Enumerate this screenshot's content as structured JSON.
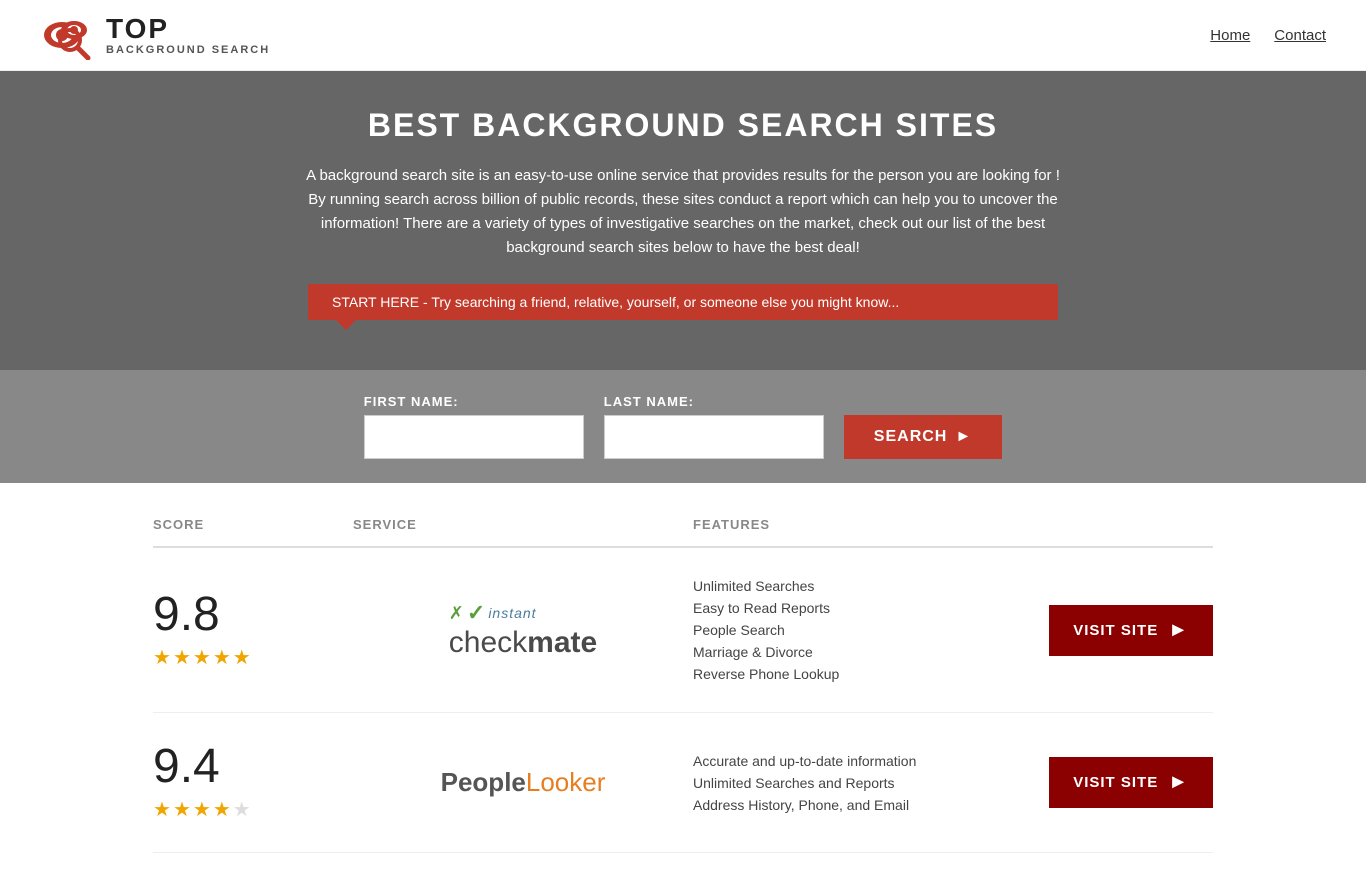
{
  "header": {
    "logo_top": "TOP",
    "logo_bottom": "BACKGROUND SEARCH",
    "nav_home": "Home",
    "nav_contact": "Contact"
  },
  "hero": {
    "title": "BEST BACKGROUND SEARCH SITES",
    "description": "A background search site is an easy-to-use online service that provides results  for the person you are looking for ! By  running  search across billion of public records, these sites conduct  a report which can help you to uncover the information! There are a variety of types of investigative searches on the market, check out our  list of the best background search sites below to have the best deal!",
    "callout": "START HERE - Try searching a friend, relative, yourself, or someone else you might know..."
  },
  "search_form": {
    "first_name_label": "FIRST NAME:",
    "last_name_label": "LAST NAME:",
    "button_label": "SEARCH"
  },
  "table": {
    "headers": {
      "score": "SCORE",
      "service": "SERVICE",
      "features": "FEATURES",
      "action": ""
    },
    "rows": [
      {
        "score": "9.8",
        "stars": 4.5,
        "service_name": "Instant Checkmate",
        "features": [
          "Unlimited Searches",
          "Easy to Read Reports",
          "People Search",
          "Marriage & Divorce",
          "Reverse Phone Lookup"
        ],
        "visit_label": "VISIT SITE"
      },
      {
        "score": "9.4",
        "stars": 4,
        "service_name": "PeopleLooker",
        "features": [
          "Accurate and up-to-date information",
          "Unlimited Searches and Reports",
          "Address History, Phone, and Email"
        ],
        "visit_label": "VISIT SITE"
      }
    ]
  }
}
